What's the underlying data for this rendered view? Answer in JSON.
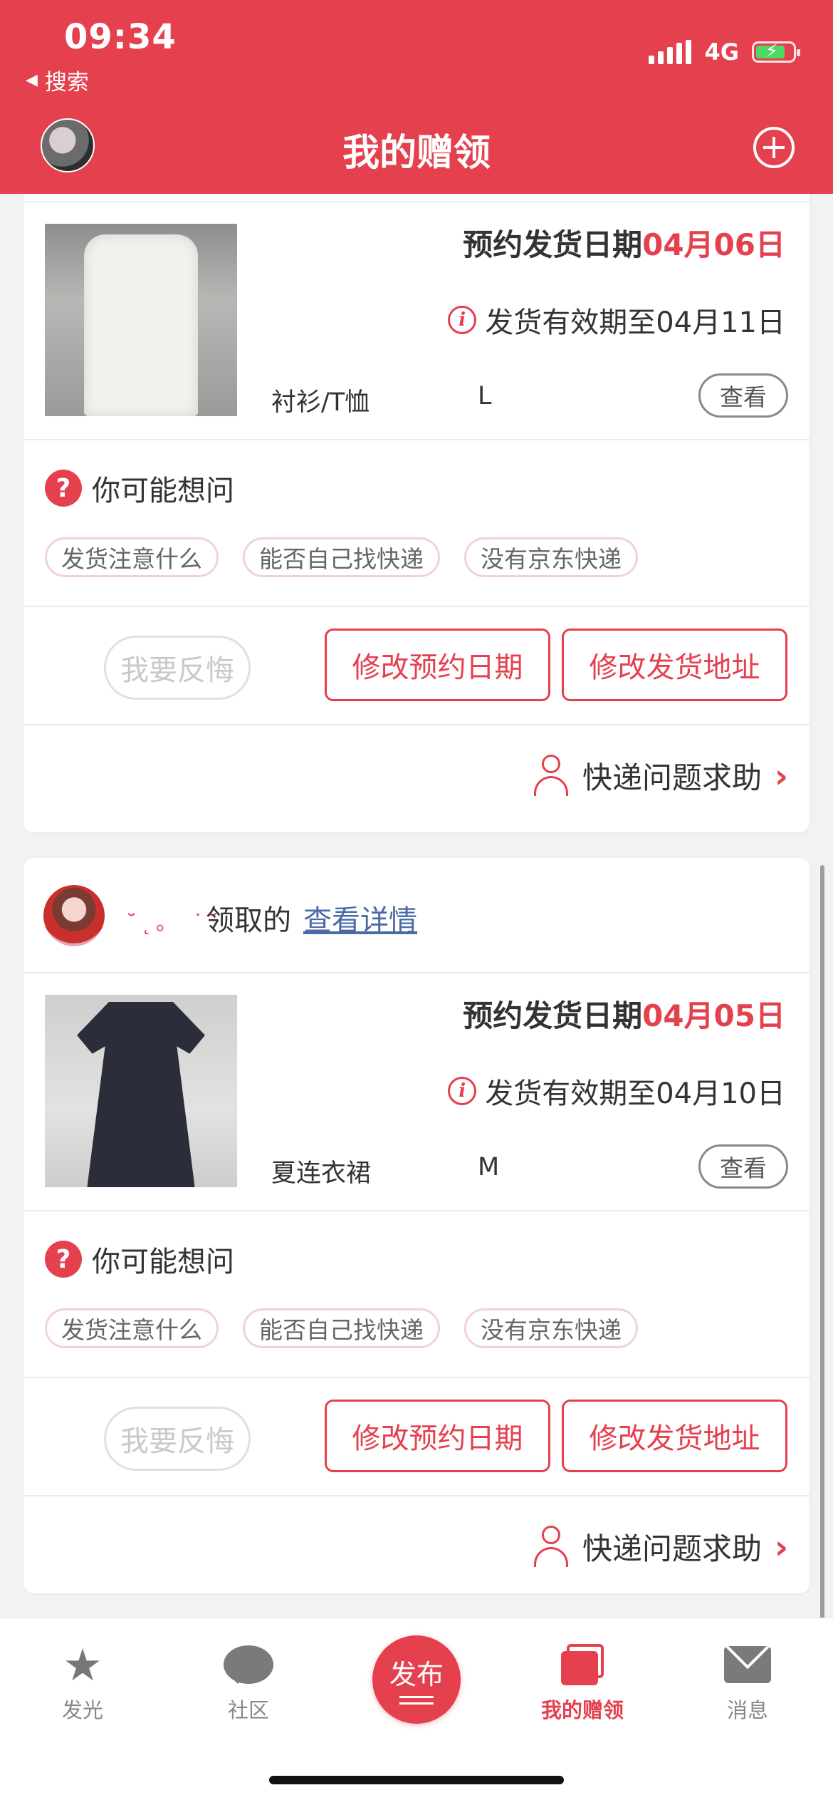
{
  "status_bar": {
    "time": "09:34",
    "back_label": "搜索",
    "network": "4G"
  },
  "header": {
    "title": "我的赠领"
  },
  "cards": [
    {
      "ship_date_label": "预约发货日期",
      "ship_date": "04月06日",
      "valid_until": "发货有效期至04月11日",
      "category": "衬衫/T恤",
      "size": "L",
      "view_label": "查看"
    },
    {
      "donor_name": "˘˛。 ˙˘",
      "donor_suffix": "领取的",
      "detail_link": "查看详情",
      "ship_date_label": "预约发货日期",
      "ship_date": "04月05日",
      "valid_until": "发货有效期至04月10日",
      "category": "夏连衣裙",
      "size": "M",
      "view_label": "查看"
    }
  ],
  "faq": {
    "title": "你可能想问",
    "tags": [
      "发货注意什么",
      "能否自己找快递",
      "没有京东快递"
    ]
  },
  "actions": {
    "regret": "我要反悔",
    "change_date": "修改预约日期",
    "change_address": "修改发货地址"
  },
  "help": {
    "label": "快递问题求助"
  },
  "tabbar": {
    "glow": "发光",
    "community": "社区",
    "publish": "发布",
    "my_gifts": "我的赠领",
    "messages": "消息"
  },
  "colors": {
    "brand": "#e5404e",
    "link": "#4a6aa6"
  }
}
